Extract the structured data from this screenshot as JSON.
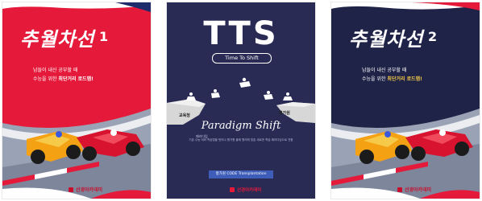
{
  "books": [
    {
      "title": "추월차선",
      "number": "1",
      "subtitle_line1": "남들이 내신 공부할 때",
      "subtitle_line2_pre": "수능을 위한 ",
      "subtitle_line2_bold": "최단거리 로드맵!",
      "publisher": "선경아카데미"
    },
    {
      "title": "TTS",
      "pill": "Time To Shift",
      "left_label": "교육청",
      "right_label": "평가원",
      "paradigm": "Paradigm Shift",
      "small_caption": "패러다임",
      "description": "기존 수능 대비 학습법을 벗어나 평가원 출제 원리에 맞춘 새로운 학습 패러다임으로 전환",
      "band": "평가원 CODE Transplantation",
      "publisher": "선경아카데미"
    },
    {
      "title": "추월차선",
      "number": "2",
      "subtitle_line1": "남들이 내신 공부할 때",
      "subtitle_line2_pre": "수능을 위한 ",
      "subtitle_line2_bold": "최단거리 로드맵!",
      "publisher": "선경아카데미"
    }
  ]
}
